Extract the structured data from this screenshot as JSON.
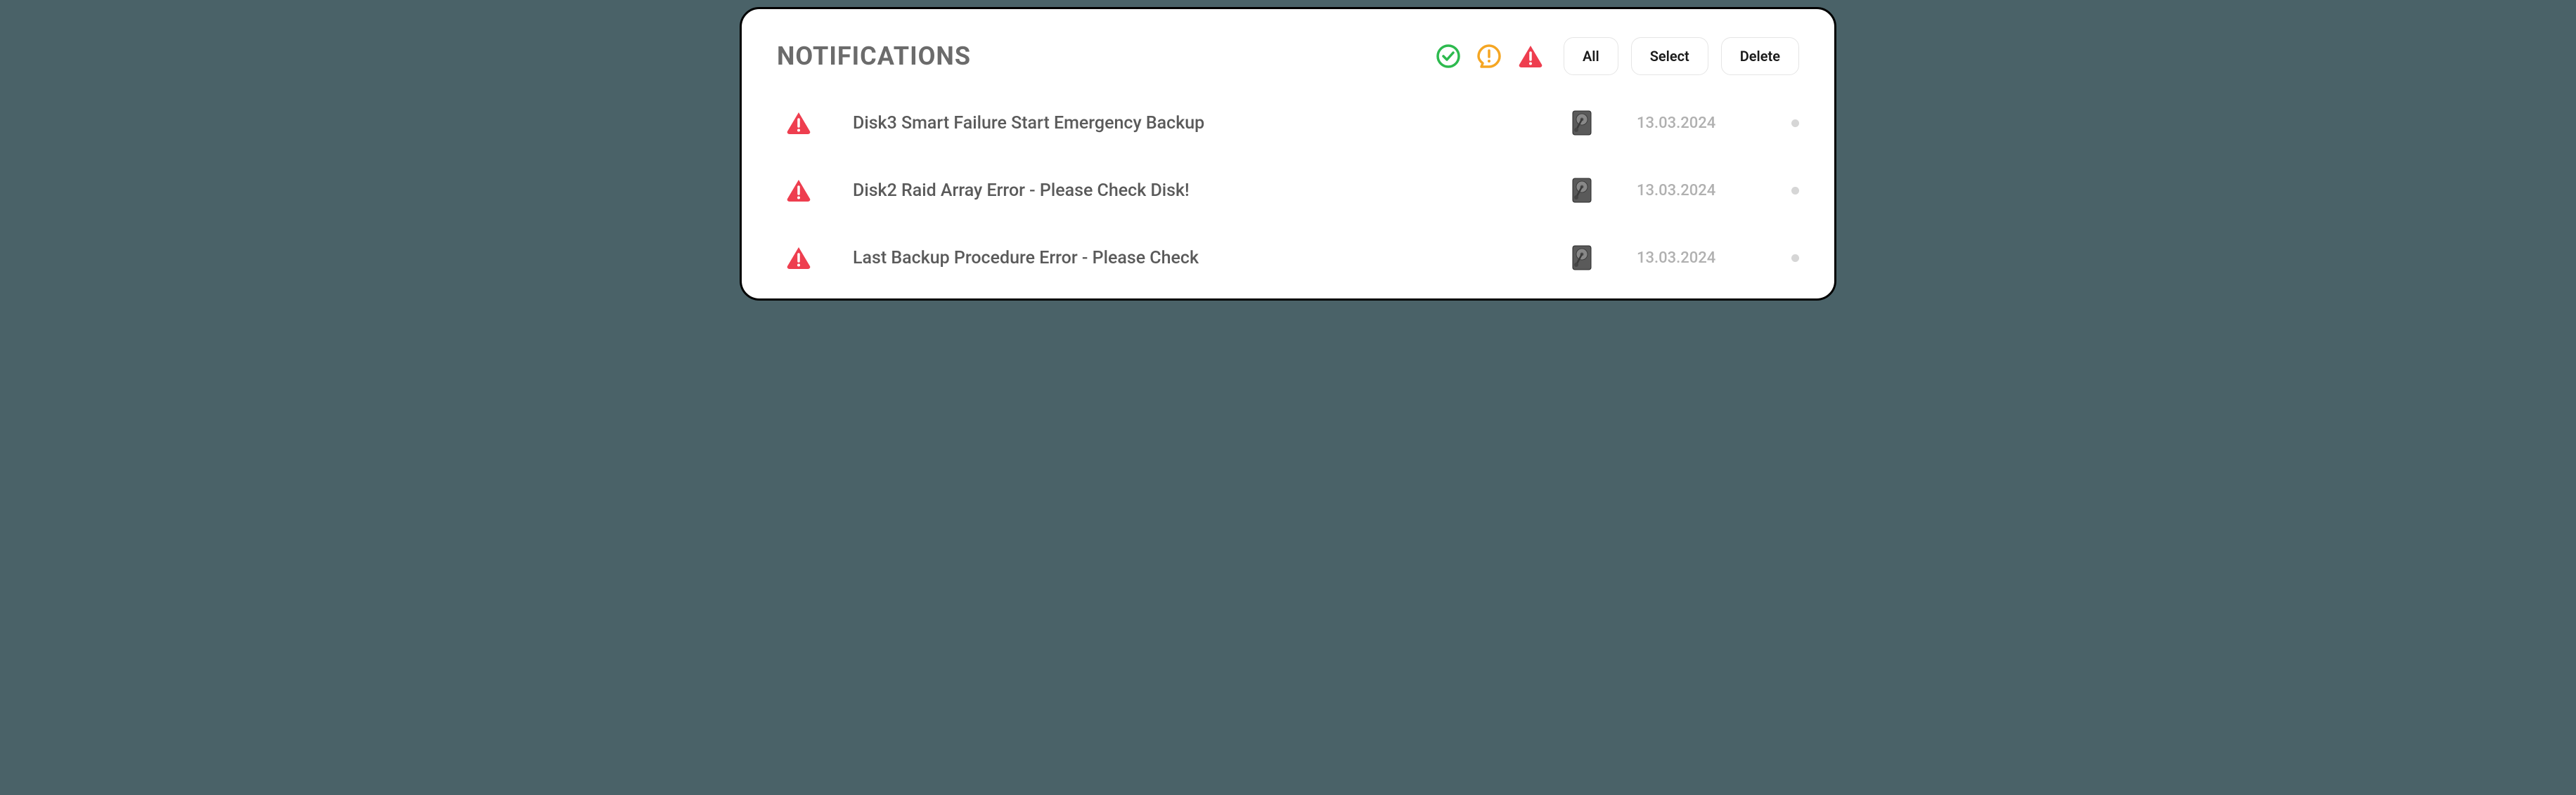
{
  "title": "NOTIFICATIONS",
  "buttons": {
    "all": "All",
    "select": "Select",
    "delete": "Delete"
  },
  "filters": {
    "success_color": "#2dba4e",
    "warning_color": "#f5a623",
    "alert_color": "#ee3e4f"
  },
  "notifications": [
    {
      "severity": "alert",
      "message": "Disk3 Smart Failure Start Emergency Backup",
      "category": "disk",
      "date": "13.03.2024"
    },
    {
      "severity": "alert",
      "message": "Disk2 Raid Array Error - Please Check Disk!",
      "category": "disk",
      "date": "13.03.2024"
    },
    {
      "severity": "alert",
      "message": "Last Backup Procedure Error - Please Check",
      "category": "disk",
      "date": "13.03.2024"
    }
  ]
}
